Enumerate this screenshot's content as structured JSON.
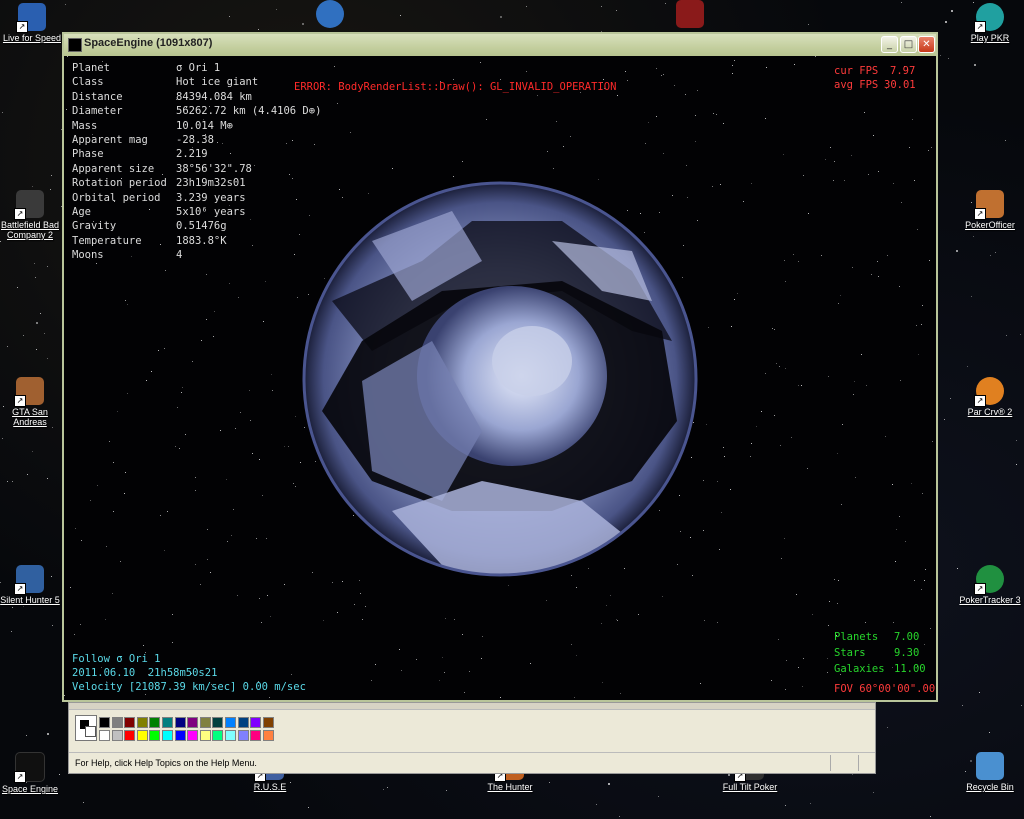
{
  "desktop": {
    "icons": [
      {
        "label": "Live for Speed",
        "icon": "lfs-icon",
        "color": "#2a5fb0"
      },
      {
        "label": "Battlefield Bad Company 2",
        "icon": "soldier-icon",
        "color": "#3a3a3a"
      },
      {
        "label": "GTA San Andreas",
        "icon": "gta-icon",
        "color": "#a06030"
      },
      {
        "label": "Silent Hunter 5",
        "icon": "submarine-icon",
        "color": "#3060a0"
      },
      {
        "label": "Space Engine",
        "icon": "space-engine-icon",
        "color": "#101010"
      },
      {
        "label": "R.U.S.E",
        "icon": "ruse-icon",
        "color": "#4060a0"
      },
      {
        "label": "The Hunter",
        "icon": "hunter-icon",
        "color": "#c06020"
      },
      {
        "label": "Full Tilt Poker",
        "icon": "full-tilt-icon",
        "color": "#303030"
      },
      {
        "label": "Play PKR",
        "icon": "pkr-icon",
        "color": "#20a0a0"
      },
      {
        "label": "PokerOfficer",
        "icon": "poker-officer-icon",
        "color": "#c07030"
      },
      {
        "label": "Par Crv® 2",
        "icon": "par-icon",
        "color": "#e08020"
      },
      {
        "label": "PokerTracker 3",
        "icon": "pokertracker-icon",
        "color": "#209040"
      },
      {
        "label": "Recycle Bin",
        "icon": "recycle-bin-icon",
        "color": "#4a90d0"
      }
    ],
    "taskbar_top_icons": [
      "planet-app-icon",
      "racing-app-icon"
    ]
  },
  "window": {
    "title": "SpaceEngine (1091x807)",
    "min": "_",
    "max": "□",
    "close": "✕"
  },
  "hud": {
    "info": [
      {
        "k": "Planet",
        "v": "σ Ori 1"
      },
      {
        "k": "Class",
        "v": "Hot ice giant"
      },
      {
        "k": "Distance",
        "v": "84394.084 km"
      },
      {
        "k": "Diameter",
        "v": "56262.72 km (4.4106 D⊕)"
      },
      {
        "k": "Mass",
        "v": "10.014 M⊕"
      },
      {
        "k": "Apparent mag",
        "v": "-28.38"
      },
      {
        "k": "Phase",
        "v": "2.219"
      },
      {
        "k": "Apparent size",
        "v": "38°56'32\".78"
      },
      {
        "k": "Rotation period",
        "v": "23h19m32s01"
      },
      {
        "k": "Orbital period",
        "v": "3.239 years"
      },
      {
        "k": "Age",
        "v": "5x10⁶ years"
      },
      {
        "k": "Gravity",
        "v": "0.51476g"
      },
      {
        "k": "Temperature",
        "v": "1883.8°K"
      },
      {
        "k": "Moons",
        "v": "4"
      }
    ],
    "error": "ERROR: BodyRenderList::Draw(): GL_INVALID_OPERATION",
    "fps_cur_label": "cur FPS",
    "fps_cur": "7.97",
    "fps_avg_label": "avg FPS",
    "fps_avg": "30.01",
    "follow": "Follow σ Ori 1",
    "datetime": "2011.06.10  21h58m50s21",
    "velocity": "Velocity [21087.39 km/sec] 0.00 m/sec",
    "mag_planets_label": "Planets",
    "mag_planets": "7.00",
    "mag_stars_label": "Stars",
    "mag_stars": "9.30",
    "mag_galaxies_label": "Galaxies",
    "mag_galaxies": "11.00",
    "fov": "FOV 60°00'00\".00"
  },
  "paint": {
    "status": "For Help, click Help Topics on the Help Menu.",
    "palette_top": [
      "#000000",
      "#808080",
      "#800000",
      "#808000",
      "#008000",
      "#008080",
      "#000080",
      "#800080",
      "#808040",
      "#004040",
      "#0080ff",
      "#004080",
      "#8000ff",
      "#804000"
    ],
    "palette_bottom": [
      "#ffffff",
      "#c0c0c0",
      "#ff0000",
      "#ffff00",
      "#00ff00",
      "#00ffff",
      "#0000ff",
      "#ff00ff",
      "#ffff80",
      "#00ff80",
      "#80ffff",
      "#8080ff",
      "#ff0080",
      "#ff8040"
    ]
  }
}
